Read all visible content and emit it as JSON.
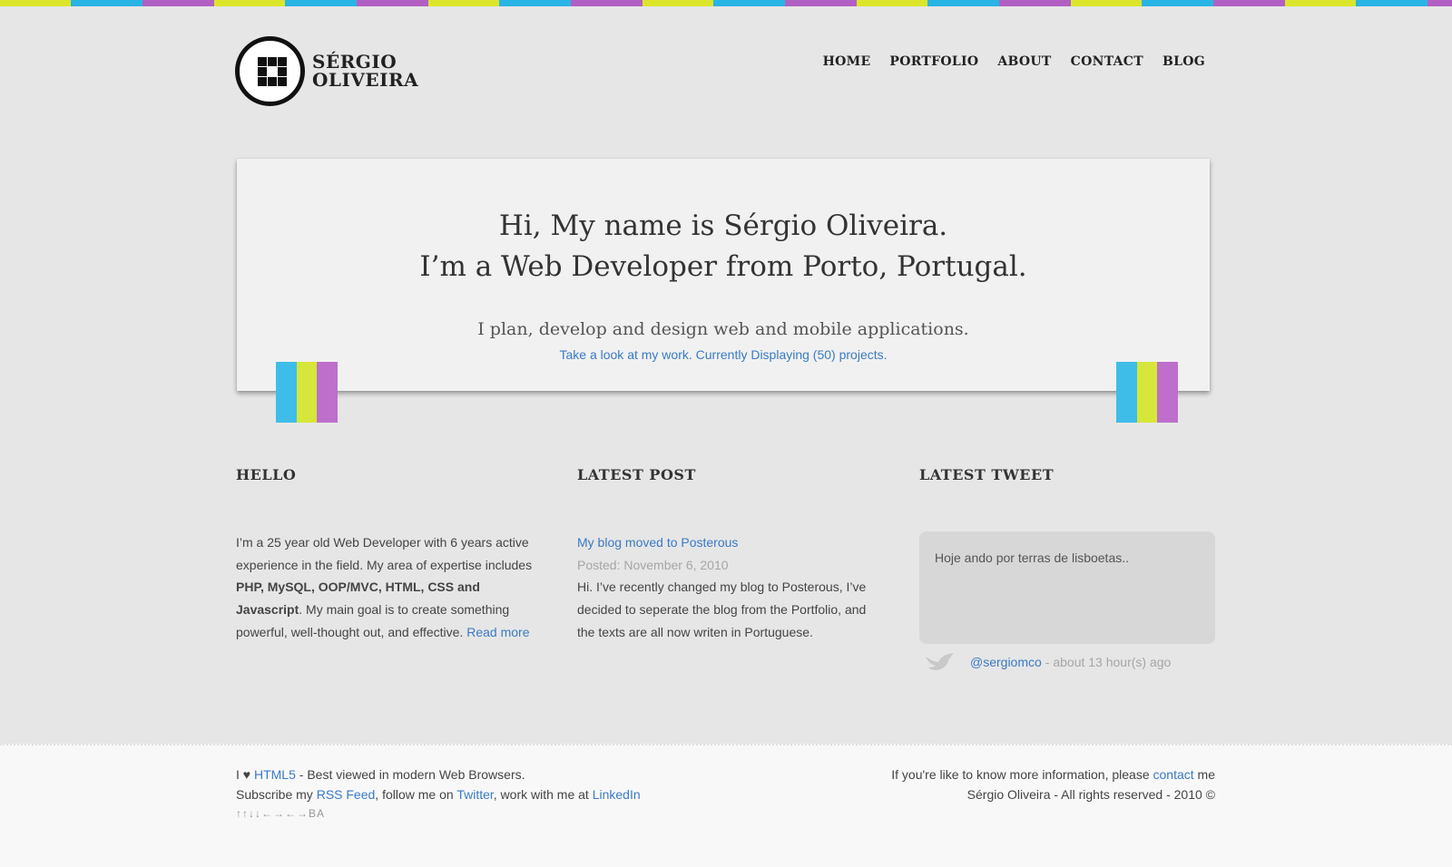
{
  "brand": {
    "name_line1": "SÉRGIO",
    "name_line2": "OLIVEIRA",
    "logo_icon": "logo-icon"
  },
  "nav": {
    "items": [
      {
        "label": "HOME"
      },
      {
        "label": "PORTFOLIO"
      },
      {
        "label": "ABOUT"
      },
      {
        "label": "CONTACT"
      },
      {
        "label": "BLOG"
      }
    ]
  },
  "hero": {
    "line1": "Hi, My name is Sérgio Oliveira.",
    "line2": "I’m a Web Developer from Porto, Portugal.",
    "subtitle": "I plan, develop and design web and mobile applications.",
    "link_text": "Take a look at my work. Currently Displaying (50) projects."
  },
  "hello": {
    "heading": "HELLO",
    "text_1": "I’m a 25 year old Web Developer with 6 years active experience in the field. My area of expertise includes ",
    "text_bold": "PHP, MySQL, OOP/MVC, HTML, CSS and Javascript",
    "text_2": ". My main goal is to create something powerful, well-thought out, and effective. ",
    "read_more": "Read more"
  },
  "latest_post": {
    "heading": "LATEST POST",
    "title": "My blog moved to Posterous",
    "date": "Posted: November 6, 2010",
    "excerpt": "Hi. I’ve recently changed my blog to Posterous, I’ve decided to seperate the blog from the Portfolio, and the texts are all now writen in Portuguese."
  },
  "latest_tweet": {
    "heading": "LATEST TWEET",
    "text": "Hoje ando por terras de lisboetas..",
    "handle": "@sergiomco",
    "ago": "- about 13 hour(s) ago",
    "icon": "twitter-bird-icon"
  },
  "footer": {
    "left": {
      "prefix_i": "I ♥ ",
      "html5": "HTML5",
      "best_viewed": " - Best viewed in modern Web Browsers.",
      "subscribe": "Subscribe my ",
      "rss": "RSS Feed",
      "follow": ", follow me on ",
      "twitter": "Twitter",
      "work": ", work with me at ",
      "linkedin": "LinkedIn",
      "konami": "↑↑↓↓←→←→BA"
    },
    "right": {
      "info": "If you're like to know more information, please ",
      "contact": "contact",
      "me": " me",
      "rights": "Sérgio Oliveira - All rights reserved - 2010 ©"
    }
  },
  "colors": {
    "background": "#e6e6e6",
    "link": "#3a7ac4",
    "cyan": "#3fbde9",
    "lime": "#d6e63a",
    "purple": "#bd6fcb"
  }
}
